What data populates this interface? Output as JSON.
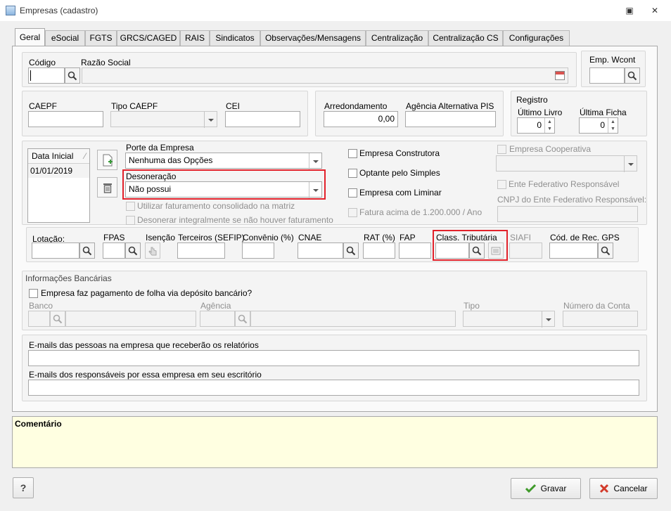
{
  "window": {
    "title": "Empresas (cadastro)"
  },
  "tabs": [
    "Geral",
    "eSocial",
    "FGTS",
    "GRCS/CAGED",
    "RAIS",
    "Sindicatos",
    "Observações/Mensagens",
    "Centralização",
    "Centralização CS",
    "Configurações"
  ],
  "top": {
    "codigo_label": "Código",
    "codigo_value": "",
    "razao_label": "Razão Social",
    "razao_value": "",
    "emp_wcont_label": "Emp. Wcont",
    "emp_wcont_value": ""
  },
  "caepf_group": {
    "caepf_label": "CAEPF",
    "tipo_caepf_label": "Tipo CAEPF",
    "cei_label": "CEI"
  },
  "arred_group": {
    "arred_label": "Arredondamento",
    "arred_value": "0,00",
    "agencia_pis_label": "Agência Alternativa PIS",
    "agencia_pis_value": ""
  },
  "registro": {
    "title": "Registro",
    "ultimo_livro_label": "Último Livro",
    "ultimo_livro_value": "0",
    "ultima_ficha_label": "Última Ficha",
    "ultima_ficha_value": "0"
  },
  "data_inicial": {
    "header": "Data Inicial",
    "rows": [
      "01/01/2019"
    ]
  },
  "porte": {
    "label": "Porte da Empresa",
    "value": "Nenhuma das Opções"
  },
  "desoneracao": {
    "label": "Desoneração",
    "value": "Não possui"
  },
  "checks_left": [
    "Utilizar faturamento consolidado na matriz",
    "Desonerar integralmente se não houver faturamento"
  ],
  "checks_mid": [
    "Empresa Construtora",
    "Optante pelo Simples",
    "Empresa com Liminar",
    "Fatura acima de 1.200.000 / Ano"
  ],
  "right_col": {
    "coop_label": "Empresa Cooperativa",
    "ente_label": "Ente Federativo Responsável",
    "cnpj_ente_label": "CNPJ do Ente Federativo Responsável:"
  },
  "row_fields": {
    "lotacao": "Lotação:",
    "fpas": "FPAS",
    "isencao": "Isenção",
    "terceiros": "Terceiros (SEFIP)",
    "convenio": "Convênio (%)",
    "cnae": "CNAE",
    "rat": "RAT (%)",
    "fap": "FAP",
    "class_trib": "Class. Tributária",
    "siafi": "SIAFI",
    "cod_gps": "Cód. de Rec. GPS"
  },
  "bancarias": {
    "title": "Informações Bancárias",
    "check_label": "Empresa faz pagamento de folha via depósito bancário?",
    "banco": "Banco",
    "agencia": "Agência",
    "tipo": "Tipo",
    "numero_conta": "Número da Conta"
  },
  "emails": {
    "pessoas_label": "E-mails das pessoas na empresa que receberão os relatórios",
    "responsaveis_label": "E-mails dos responsáveis por essa empresa em seu escritório"
  },
  "comment": {
    "label": "Comentário"
  },
  "buttons": {
    "help": "?",
    "gravar": "Gravar",
    "cancelar": "Cancelar"
  }
}
